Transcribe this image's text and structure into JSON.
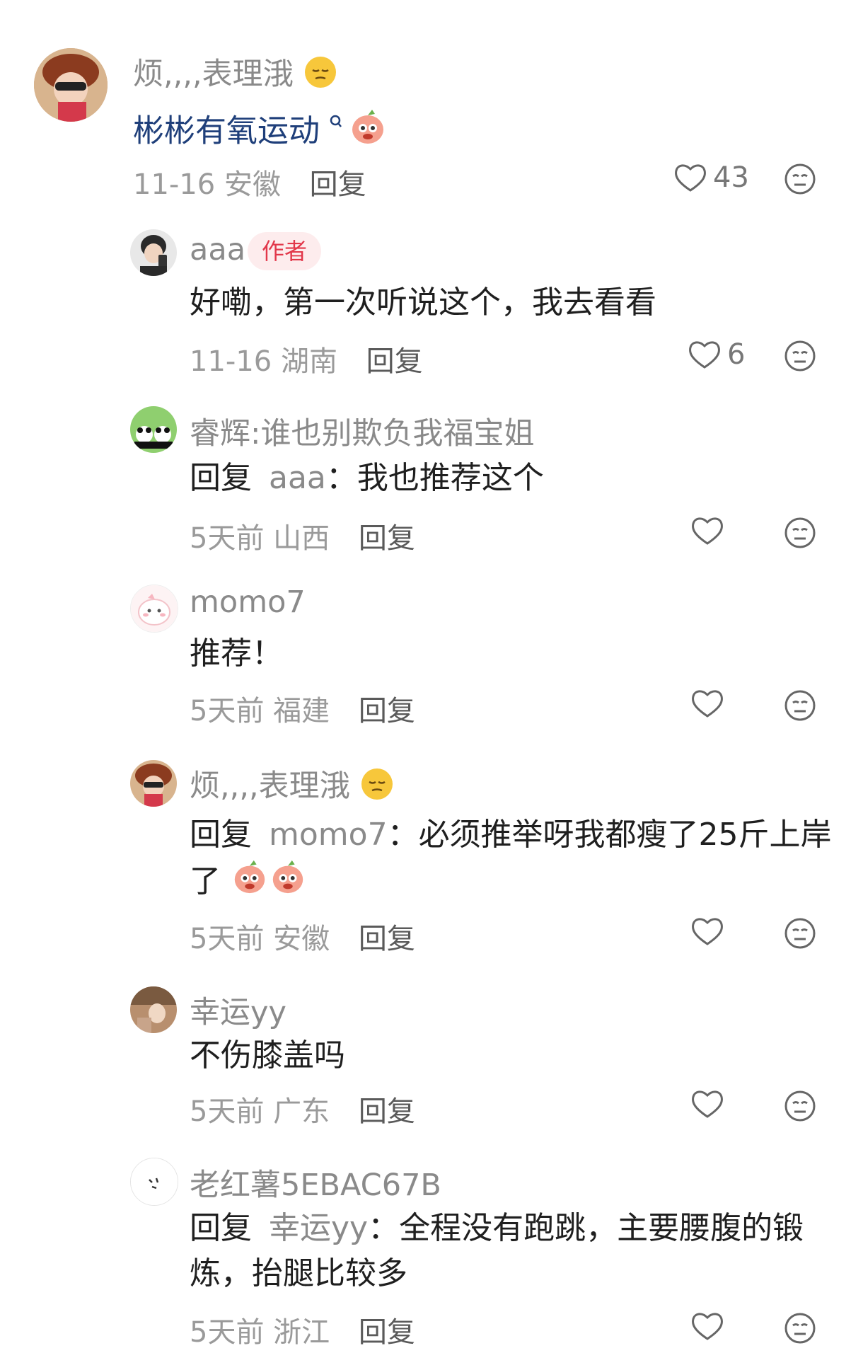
{
  "comment1": {
    "username": "烦,,,,表理涐",
    "text": "彬彬有氧运动",
    "date": "11-16",
    "location": "安徽",
    "reply_label": "回复",
    "likes": "43"
  },
  "reply1": {
    "username": "aaa",
    "badge": "作者",
    "text": "好嘞，第一次听说这个，我去看看",
    "date": "11-16",
    "location": "湖南",
    "reply_label": "回复",
    "likes": "6"
  },
  "reply2": {
    "username": "睿辉:谁也别欺负我福宝姐",
    "prefix": "回复",
    "target": "aaa",
    "text": "我也推荐这个",
    "date": "5天前",
    "location": "山西",
    "reply_label": "回复"
  },
  "reply3": {
    "username": "momo7",
    "text": "推荐！",
    "date": "5天前",
    "location": "福建",
    "reply_label": "回复"
  },
  "reply4": {
    "username": "烦,,,,表理涐",
    "prefix": "回复",
    "target": "momo7",
    "text": "必须推举呀我都瘦了25斤上岸了",
    "date": "5天前",
    "location": "安徽",
    "reply_label": "回复"
  },
  "reply5": {
    "username": "幸运yy",
    "text": "不伤膝盖吗",
    "date": "5天前",
    "location": "广东",
    "reply_label": "回复"
  },
  "reply6": {
    "username": "老红薯5EBAC67B",
    "prefix": "回复",
    "target": "幸运yy",
    "text": "全程没有跑跳，主要腰腹的锻炼，抬腿比较多",
    "date": "5天前",
    "location": "浙江",
    "reply_label": "回复"
  },
  "icons": {
    "like": "heart-outline-icon",
    "dislike": "neutral-face-icon"
  }
}
